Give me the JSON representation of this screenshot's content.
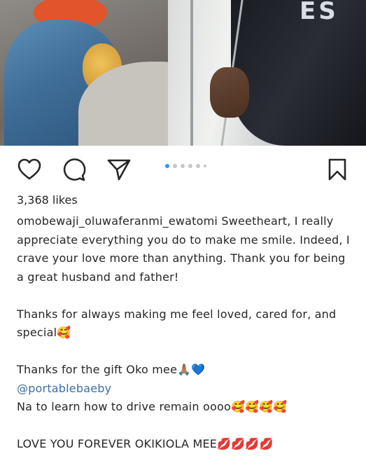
{
  "photo": {
    "alt": "Photo",
    "overlay_text": "ES"
  },
  "actions": {
    "like_icon": "heart-icon",
    "comment_icon": "comment-icon",
    "share_icon": "send-icon",
    "save_icon": "bookmark-icon"
  },
  "carousel": {
    "total": 6,
    "active_index": 0
  },
  "post": {
    "likes": "3,368 likes",
    "username": "omobewaji_oluwaferanmi_ewatomi",
    "caption_lines": [
      "Sweetheart, I really appreciate everything you do to make me smile. Indeed, I crave your love more than anything. Thank you for being a great husband and father!",
      "Thanks for always making me feel loved, cared for, and special🥰",
      "Thanks for the gift Oko mee🙏🏽💙",
      "@portablebaeby",
      "Na to learn how to drive remain oooo🥰🥰🥰🥰",
      "LOVE YOU FOREVER OKIKIOLA MEE💋💋💋💋"
    ]
  },
  "colors": {
    "accent": "#3897f0",
    "mention": "#3c6fa8",
    "text": "#262626"
  }
}
